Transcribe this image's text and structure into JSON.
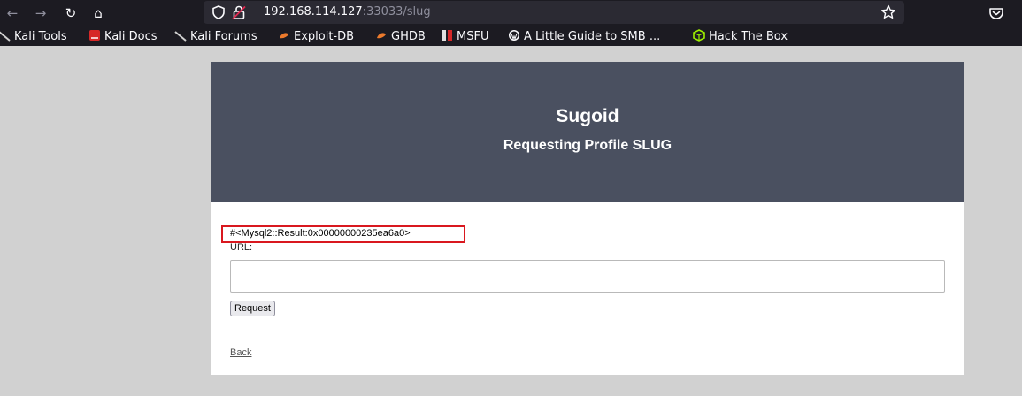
{
  "browser": {
    "url_host": "192.168.114.127",
    "url_rest": ":33033/slug",
    "nav": {
      "back_icon": "←",
      "forward_icon": "→",
      "reload_icon": "↻",
      "home_icon": "⌂"
    },
    "bookmarks": [
      {
        "label": "Kali Tools",
        "icon": "kali-dragon-icon"
      },
      {
        "label": "Kali Docs",
        "icon": "kali-docs-icon"
      },
      {
        "label": "Kali Forums",
        "icon": "kali-dragon-icon"
      },
      {
        "label": "Exploit-DB",
        "icon": "exploit-db-icon"
      },
      {
        "label": "GHDB",
        "icon": "exploit-db-icon"
      },
      {
        "label": "MSFU",
        "icon": "msfu-icon"
      },
      {
        "label": "A Little Guide to SMB ...",
        "icon": "wordpress-icon"
      },
      {
        "label": "Hack The Box",
        "icon": "hackthebox-icon"
      }
    ]
  },
  "page": {
    "title": "Sugoid",
    "subtitle": "Requesting Profile SLUG",
    "result": "#<Mysql2::Result:0x00000000235ea6a0>",
    "url_label": "URL:",
    "url_input_value": "",
    "request_button": "Request",
    "back_link": "Back"
  },
  "colors": {
    "header_bg": "#4a5060",
    "highlight_border": "#d9181f",
    "browser_bg": "#1c1b22",
    "page_bg": "#d1d1d1"
  }
}
